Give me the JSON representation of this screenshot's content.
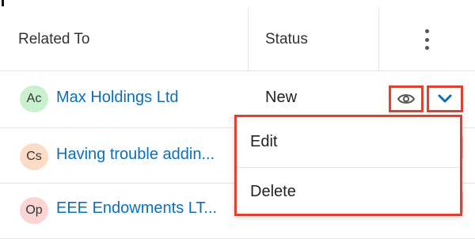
{
  "header": {
    "related_to": "Related To",
    "status": "Status"
  },
  "rows": [
    {
      "badge": "Ac",
      "badge_color": "#c9f0cf",
      "related_to": "Max Holdings Ltd",
      "status": "New"
    },
    {
      "badge": "Cs",
      "badge_color": "#fcdcc6",
      "related_to": "Having trouble addin...",
      "status": ""
    },
    {
      "badge": "Op",
      "badge_color": "#fbd4d4",
      "related_to": "EEE Endowments LT...",
      "status": ""
    }
  ],
  "row_actions": {
    "preview_icon": "eye-icon",
    "menu_icon": "chevron-down-icon"
  },
  "dropdown": {
    "items": [
      "Edit",
      "Delete"
    ]
  },
  "colors": {
    "link": "#0b6fba",
    "highlight": "#e0402e"
  }
}
